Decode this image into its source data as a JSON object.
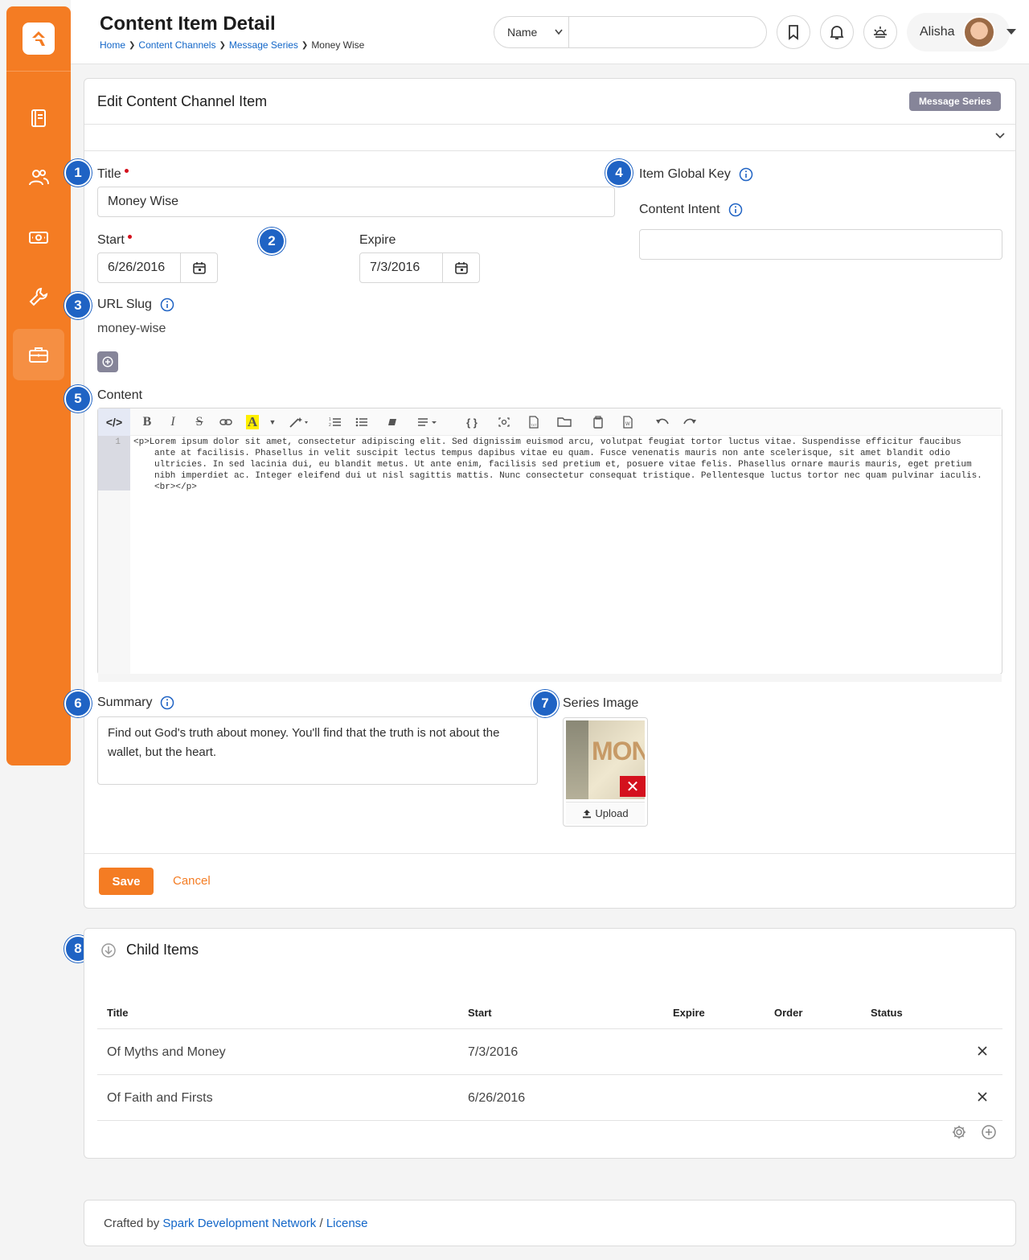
{
  "header": {
    "title": "Content Item Detail",
    "breadcrumb": [
      "Home",
      "Content Channels",
      "Message Series",
      "Money Wise"
    ],
    "search": {
      "select_value": "Name",
      "placeholder": ""
    },
    "user": {
      "name": "Alisha"
    }
  },
  "sidebar": {
    "icons": [
      "logo-icon",
      "book-icon",
      "people-icon",
      "money-icon",
      "wrench-icon",
      "briefcase-icon"
    ]
  },
  "edit_card": {
    "title": "Edit Content Channel Item",
    "badge": "Message Series",
    "fields": {
      "title_label": "Title",
      "title_value": "Money Wise",
      "start_label": "Start",
      "start_value": "6/26/2016",
      "expire_label": "Expire",
      "expire_value": "7/3/2016",
      "slug_label": "URL Slug",
      "slug_value": "money-wise",
      "global_key_label": "Item Global Key",
      "intent_label": "Content Intent",
      "intent_value": "",
      "content_label": "Content",
      "content_line_number": "1",
      "content_value": "<p>Lorem ipsum dolor sit amet, consectetur adipiscing elit. Sed dignissim euismod arcu, volutpat feugiat tortor luctus vitae. Suspendisse efficitur faucibus ante at facilisis. Phasellus in velit suscipit lectus tempus dapibus vitae eu quam. Fusce venenatis mauris non ante scelerisque, sit amet blandit odio ultricies. In sed lacinia dui, eu blandit metus. Ut ante enim, facilisis sed pretium et, posuere vitae felis. Phasellus ornare mauris mauris, eget pretium nibh imperdiet ac. Integer eleifend dui ut nisl sagittis mattis. Nunc consectetur consequat tristique. Pellentesque luctus tortor nec quam pulvinar iaculis.<br></p>",
      "summary_label": "Summary",
      "summary_value": "Find out God's truth about money. You'll find that the truth is not about the wallet, but the heart.",
      "image_label": "Series Image",
      "image_thumb_text": "MON",
      "upload_label": "Upload"
    },
    "save_label": "Save",
    "cancel_label": "Cancel"
  },
  "markers": [
    "1",
    "2",
    "3",
    "4",
    "5",
    "6",
    "7",
    "8"
  ],
  "child_items": {
    "title": "Child Items",
    "columns": [
      "Title",
      "Start",
      "Expire",
      "Order",
      "Status"
    ],
    "rows": [
      {
        "title": "Of Myths and Money",
        "start": "7/3/2016",
        "expire": "",
        "order": "",
        "status": ""
      },
      {
        "title": "Of Faith and Firsts",
        "start": "6/26/2016",
        "expire": "",
        "order": "",
        "status": ""
      }
    ]
  },
  "footer": {
    "prefix": "Crafted by",
    "org_link": "Spark Development Network",
    "slash": "/",
    "license_link": "License"
  },
  "colors": {
    "brand": "#f47c23",
    "marker": "#1f63c4",
    "link": "#1266c8",
    "badge": "#868599",
    "danger": "#d4111d"
  }
}
